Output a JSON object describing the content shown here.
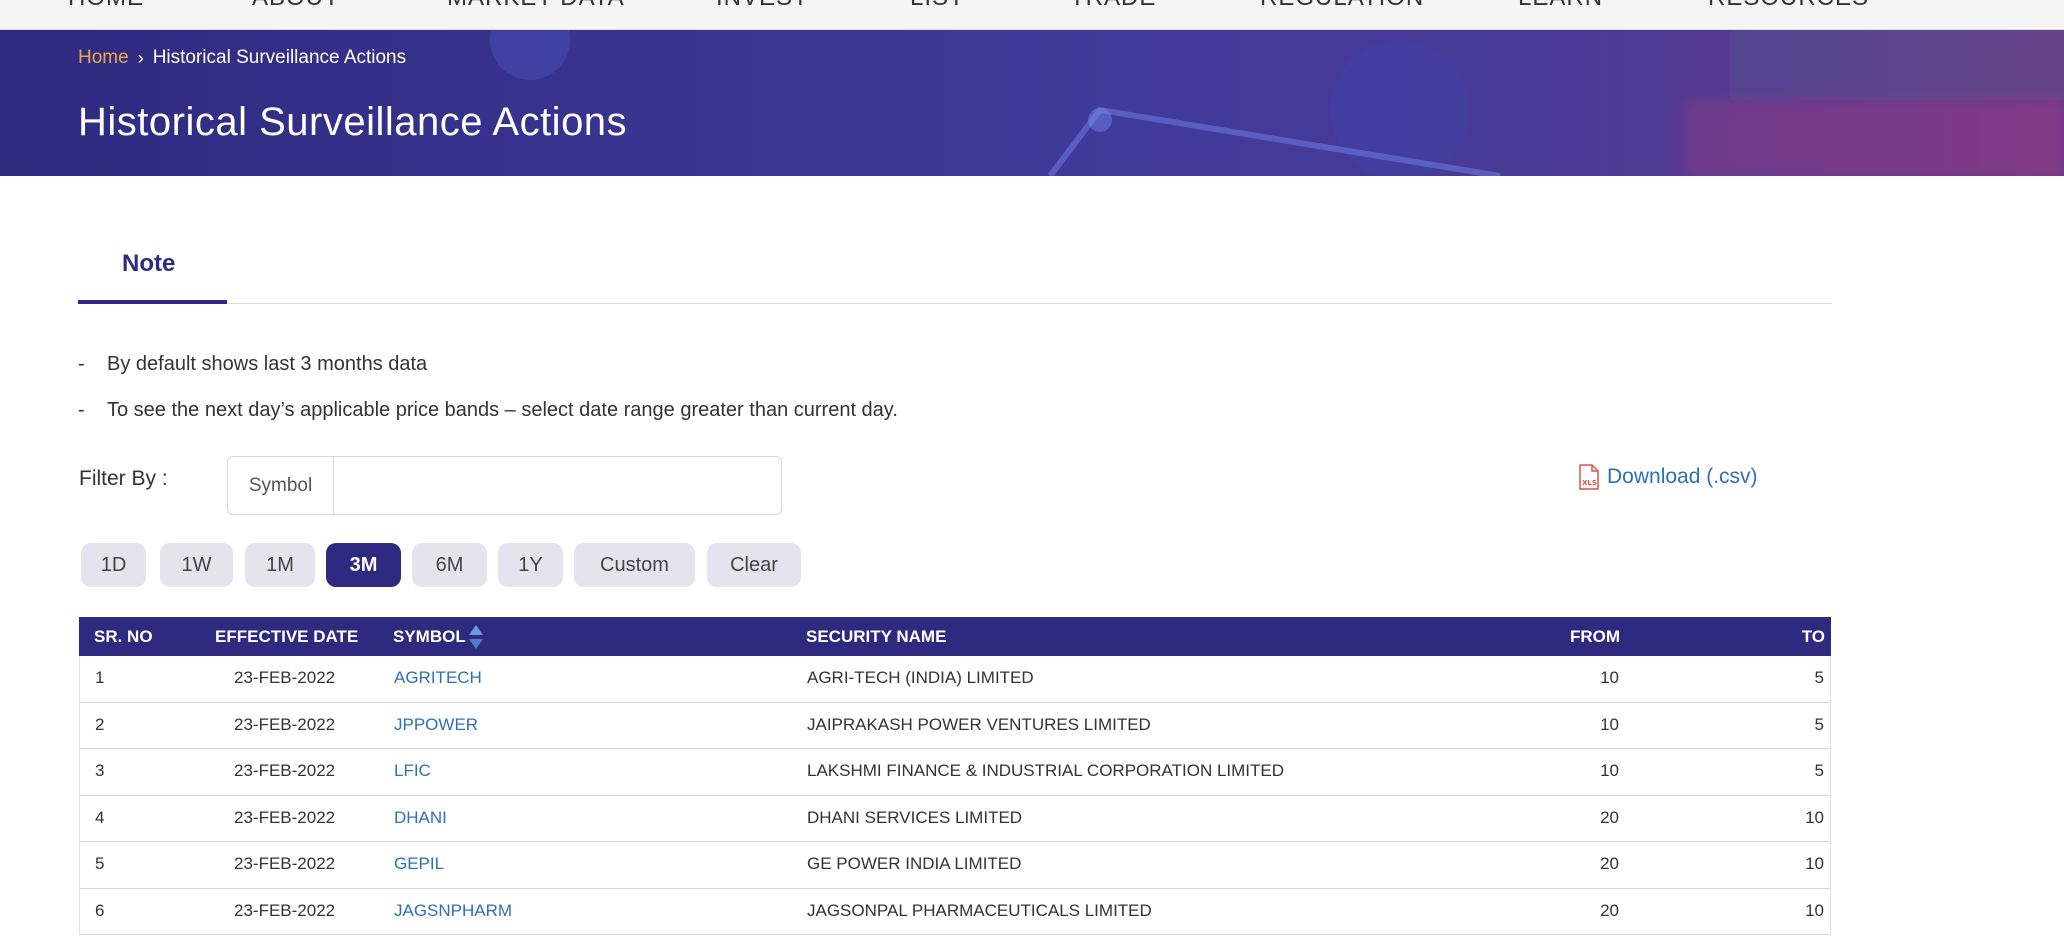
{
  "nav": {
    "items": [
      "HOME",
      "ABOUT",
      "MARKET DATA",
      "INVEST",
      "LIST",
      "TRADE",
      "REGULATION",
      "LEARN",
      "RESOURCES"
    ]
  },
  "banner": {
    "breadcrumb_home": "Home",
    "breadcrumb_current": "Historical Surveillance Actions",
    "title": "Historical Surveillance Actions"
  },
  "tabs": {
    "note_label": "Note"
  },
  "notes": {
    "line1": "By default shows last 3 months data",
    "line2": "To see the next day’s applicable price bands – select date range greater than current day."
  },
  "filter": {
    "label": "Filter By :",
    "symbol_addon": "Symbol",
    "symbol_value": "",
    "download_label": "Download (.csv)"
  },
  "periods": [
    "1D",
    "1W",
    "1M",
    "3M",
    "6M",
    "1Y",
    "Custom",
    "Clear"
  ],
  "active_period": "3M",
  "table": {
    "headers": {
      "sr_no": "SR. NO",
      "effective_date": "EFFECTIVE DATE",
      "symbol": "SYMBOL",
      "security_name": "SECURITY NAME",
      "from": "FROM",
      "to": "TO"
    },
    "rows": [
      {
        "sr_no": "1",
        "effective_date": "23-FEB-2022",
        "symbol": "AGRITECH",
        "security_name": "AGRI-TECH (INDIA) LIMITED",
        "from": "10",
        "to": "5"
      },
      {
        "sr_no": "2",
        "effective_date": "23-FEB-2022",
        "symbol": "JPPOWER",
        "security_name": "JAIPRAKASH POWER VENTURES LIMITED",
        "from": "10",
        "to": "5"
      },
      {
        "sr_no": "3",
        "effective_date": "23-FEB-2022",
        "symbol": "LFIC",
        "security_name": "LAKSHMI FINANCE & INDUSTRIAL CORPORATION LIMITED",
        "from": "10",
        "to": "5"
      },
      {
        "sr_no": "4",
        "effective_date": "23-FEB-2022",
        "symbol": "DHANI",
        "security_name": "DHANI SERVICES LIMITED",
        "from": "20",
        "to": "10"
      },
      {
        "sr_no": "5",
        "effective_date": "23-FEB-2022",
        "symbol": "GEPIL",
        "security_name": "GE POWER INDIA LIMITED",
        "from": "20",
        "to": "10"
      },
      {
        "sr_no": "6",
        "effective_date": "23-FEB-2022",
        "symbol": "JAGSNPHARM",
        "security_name": "JAGSONPAL PHARMACEUTICALS LIMITED",
        "from": "20",
        "to": "10"
      }
    ]
  },
  "colors": {
    "brand_primary": "#2e2a80",
    "breadcrumb_home": "#f3a64a",
    "link": "#2f6fb8",
    "period_button": "#e4e3ee"
  },
  "icons": {
    "download": "xls-file-icon",
    "sort": "sort-icon",
    "breadcrumb_separator": "chevron-right-icon"
  }
}
